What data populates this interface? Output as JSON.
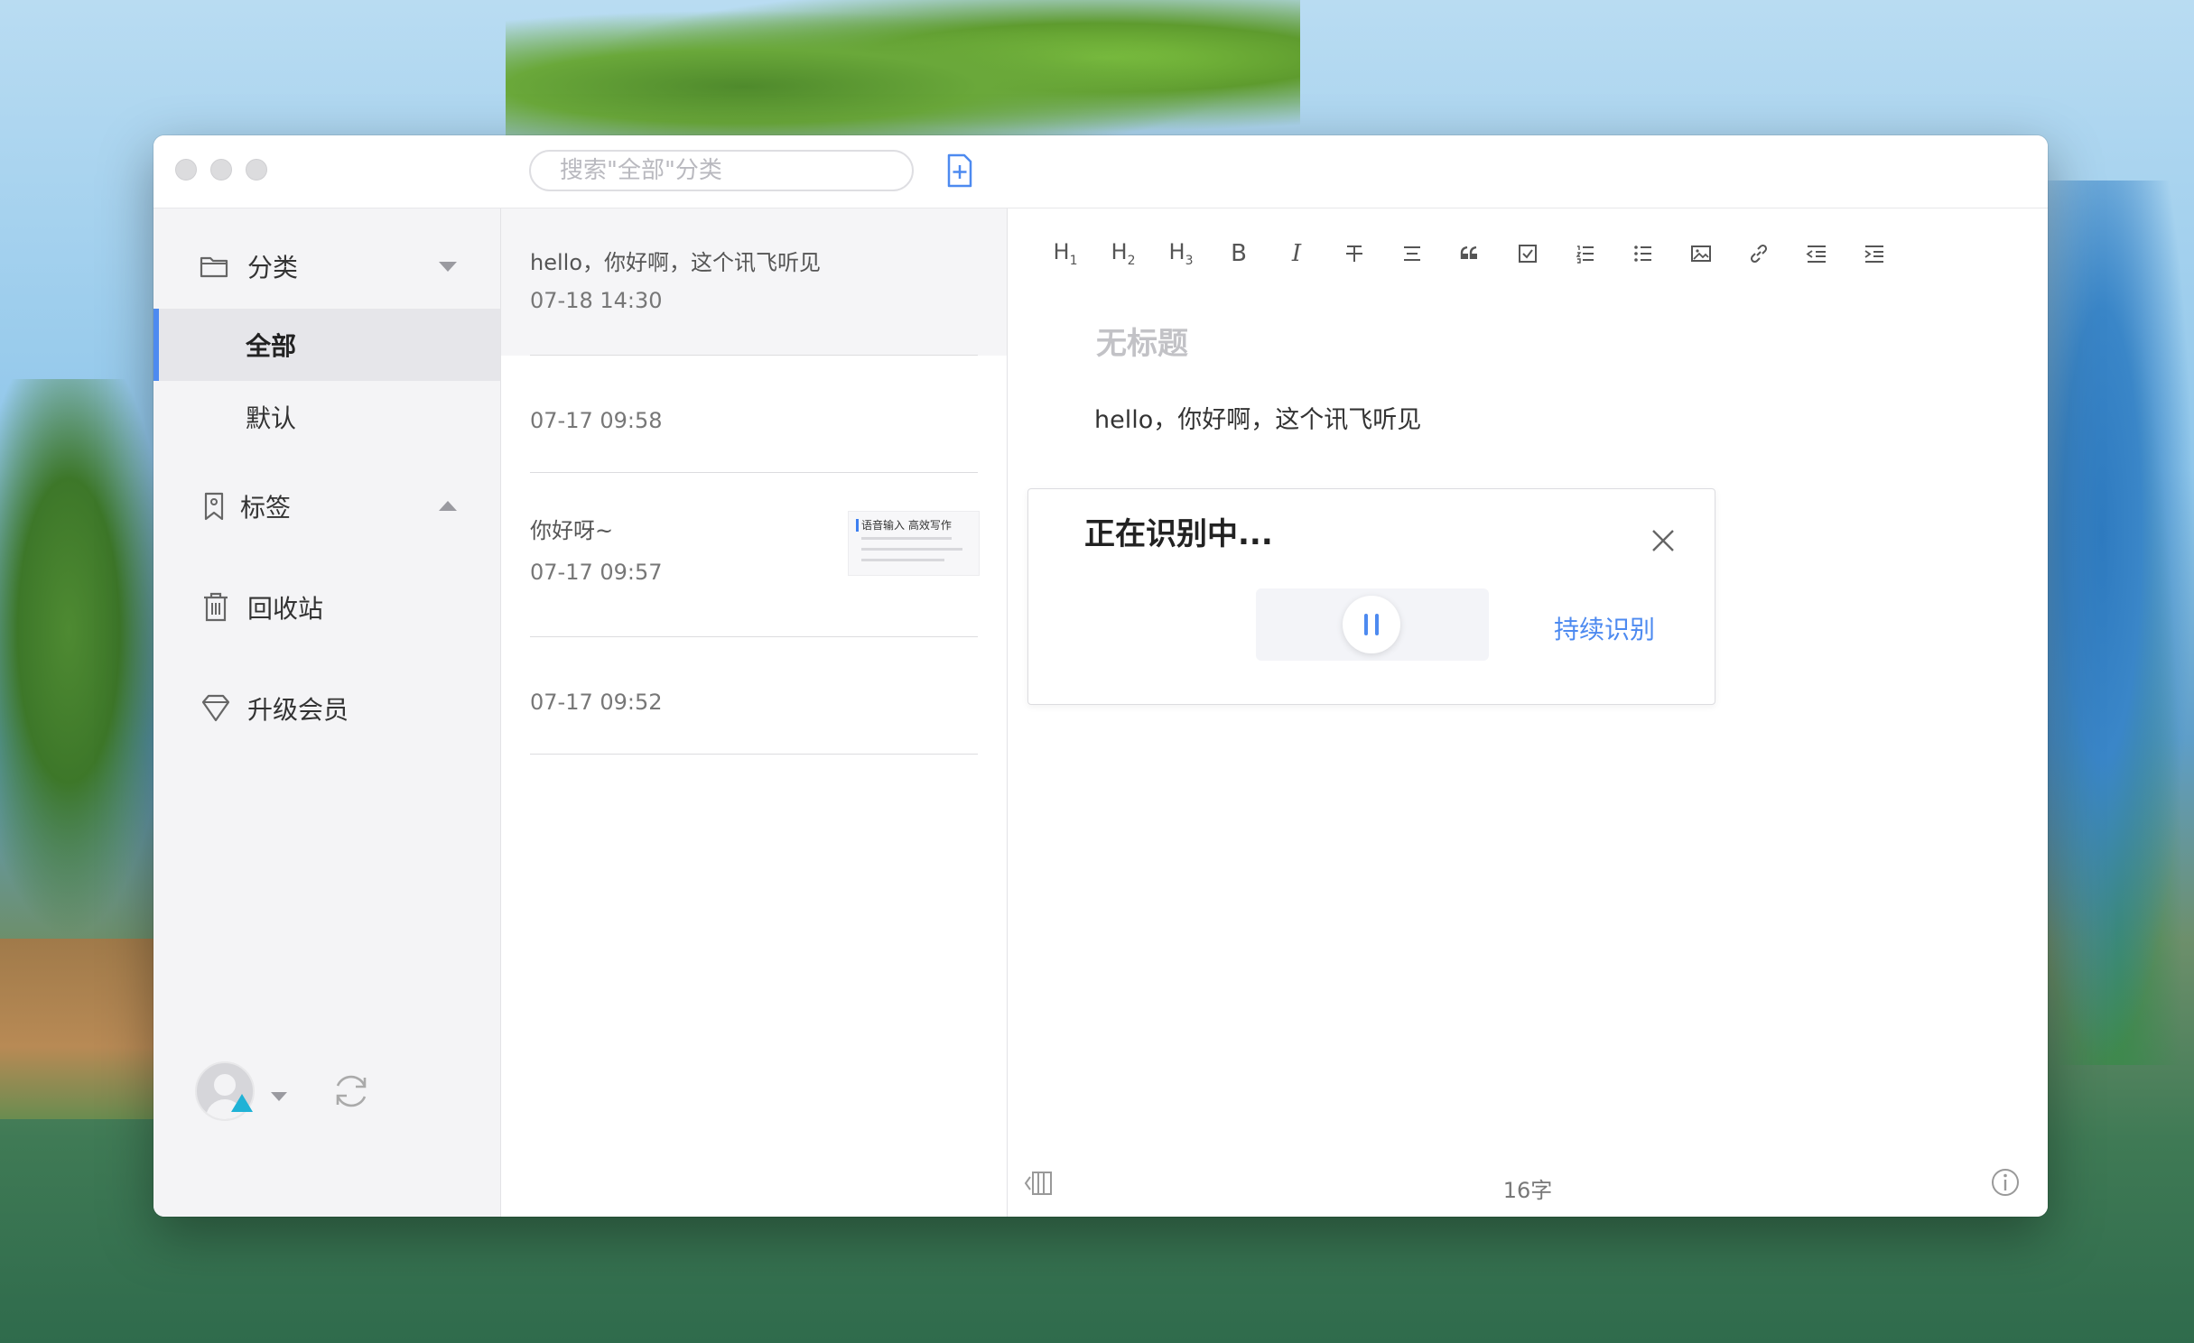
{
  "window": {
    "accent_color": "#4d8af0"
  },
  "titlebar": {
    "traffic_lights": [
      "close",
      "minimize",
      "zoom"
    ],
    "search_placeholder": "搜索\"全部\"分类",
    "new_note_icon": "new-note-icon"
  },
  "sidebar": {
    "category": {
      "label": "分类",
      "icon": "folder-icon"
    },
    "sub_items": [
      {
        "label": "全部",
        "active": true
      },
      {
        "label": "默认",
        "active": false
      }
    ],
    "tags": {
      "label": "标签",
      "icon": "tag-icon"
    },
    "trash": {
      "label": "回收站",
      "icon": "trash-icon"
    },
    "upgrade": {
      "label": "升级会员",
      "icon": "diamond-icon"
    }
  },
  "notes": [
    {
      "title": "hello，你好啊，这个讯飞听见",
      "date": "07-18 14:30",
      "selected": true
    },
    {
      "title": "",
      "date": "07-17 09:58"
    },
    {
      "title": "你好呀~",
      "date": "07-17 09:57",
      "thumbnail_title": "语音输入 高效写作"
    },
    {
      "title": "",
      "date": "07-17 09:52"
    }
  ],
  "editor": {
    "toolbar": [
      "H1",
      "H2",
      "H3",
      "B",
      "I",
      "strikethrough",
      "align",
      "quote",
      "checkbox",
      "ordered-list",
      "bullet-list",
      "image",
      "link",
      "outdent",
      "indent"
    ],
    "title_placeholder": "无标题",
    "body": "hello，你好啊，这个讯飞听见",
    "word_count": "16字"
  },
  "asr_panel": {
    "status": "正在识别中...",
    "continuous_label": "持续识别"
  },
  "right_rail": [
    "text-format-icon",
    "microphone-icon",
    "bookmark-icon",
    "share-icon"
  ]
}
